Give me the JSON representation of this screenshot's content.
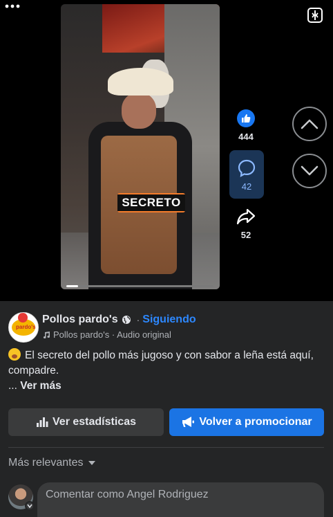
{
  "video": {
    "sticker_text": "SECRETO",
    "progress": 0.08
  },
  "rail": {
    "like_count": "444",
    "comment_count": "42",
    "share_count": "52"
  },
  "post": {
    "page_name": "Pollos pardo's",
    "following_label": "Siguiendo",
    "audio_label": "Pollos pardo's · Audio original",
    "description": "El secreto del pollo más jugoso y con sabor a leña está aquí, compadre.",
    "see_more_prefix": "... ",
    "see_more_label": "Ver más",
    "avatar_logo_text": "pardo's"
  },
  "actions": {
    "stats_label": "Ver estadísticas",
    "promote_label": "Volver a promocionar"
  },
  "comments": {
    "sort_label": "Más relevantes",
    "input_placeholder": "Comentar como Angel Rodriguez"
  },
  "colors": {
    "accent_blue": "#1877f2",
    "link_blue": "#2d88ff",
    "panel_bg": "#242526",
    "sticker_orange": "#f47c2b"
  },
  "icons": [
    "pip-icon",
    "thumbs-up-icon",
    "comment-icon",
    "share-icon",
    "more-icon",
    "chevron-up-icon",
    "chevron-down-icon",
    "globe-icon",
    "music-icon",
    "bar-chart-icon",
    "megaphone-icon",
    "caret-down-icon"
  ]
}
